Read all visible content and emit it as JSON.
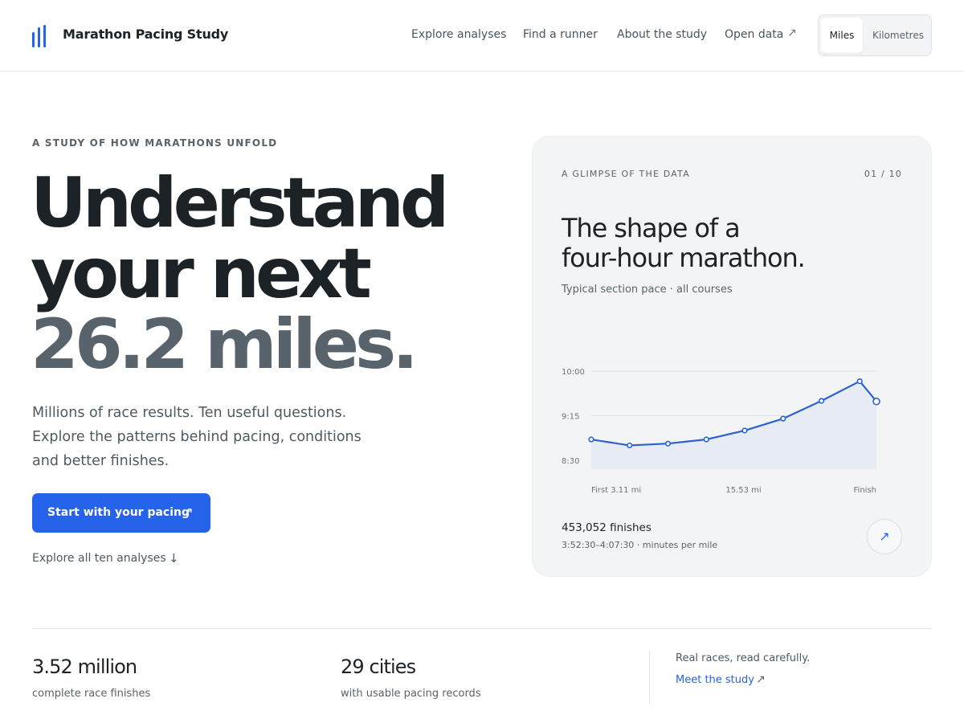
{
  "header": {
    "brand": "Marathon Pacing Study",
    "nav": [
      "Explore analyses",
      "Find a runner",
      "About the study",
      "Open data"
    ],
    "units": {
      "miles": "Miles",
      "km": "Kilometres",
      "selected": "Miles"
    }
  },
  "hero": {
    "eyebrow": "A STUDY OF HOW MARATHONS UNFOLD",
    "line1": "Understand",
    "line2": "your next",
    "line3": "26.2 miles.",
    "lead": "Millions of race results. Ten useful questions. Explore the patterns behind pacing, conditions and better finishes.",
    "cta": "Start with your pacing",
    "explore_all": "Explore all ten analyses"
  },
  "card": {
    "eyebrow": "A GLIMPSE OF THE DATA",
    "count": "01 / 10",
    "title_line1": "The shape of a",
    "title_line2": "four-hour marathon.",
    "subtitle": "Typical section pace · all courses",
    "finishes": "453,052 finishes",
    "range": "3:52:30–4:07:30 · minutes per mile"
  },
  "chart_data": {
    "type": "area",
    "title": "",
    "xlabel": "",
    "ylabel": "",
    "x_tick_labels": [
      "First 3.11 mi",
      "15.53 mi",
      "Finish"
    ],
    "y_tick_labels": [
      "10:00",
      "9:15",
      "8:30"
    ],
    "y_tick_values_min_per_mile": [
      10.0,
      9.25,
      8.5
    ],
    "ylim_min_per_mile": [
      8.35,
      10.0
    ],
    "x_range_miles": [
      3.11,
      26.2
    ],
    "series": [
      {
        "x_miles": [
          3.11,
          6.21,
          9.32,
          12.43,
          15.53,
          18.64,
          21.75,
          24.85,
          26.2
        ],
        "values_min_per_mile": [
          8.85,
          8.75,
          8.78,
          8.85,
          9.0,
          9.2,
          9.5,
          9.83,
          9.49
        ]
      }
    ],
    "grid": "horizontal",
    "legend": "none",
    "colors": {
      "line": "#2b62cf",
      "fill": "#e7ebf3",
      "grid": "#dfe2e5"
    }
  },
  "stats": [
    {
      "value": "3.52 million",
      "label": "complete race finishes"
    },
    {
      "value": "29 cities",
      "label": "with usable pacing records"
    }
  ],
  "about": {
    "tagline": "Real races, read carefully.",
    "link": "Meet the study"
  },
  "icons": {
    "logo": "bar-chart-logo-icon",
    "external": "↗",
    "arrow_down": "↓"
  },
  "colors": {
    "accent": "#2563eb",
    "text": "#1c2226",
    "muted": "#59636b",
    "card_bg": "#f3f4f5"
  }
}
